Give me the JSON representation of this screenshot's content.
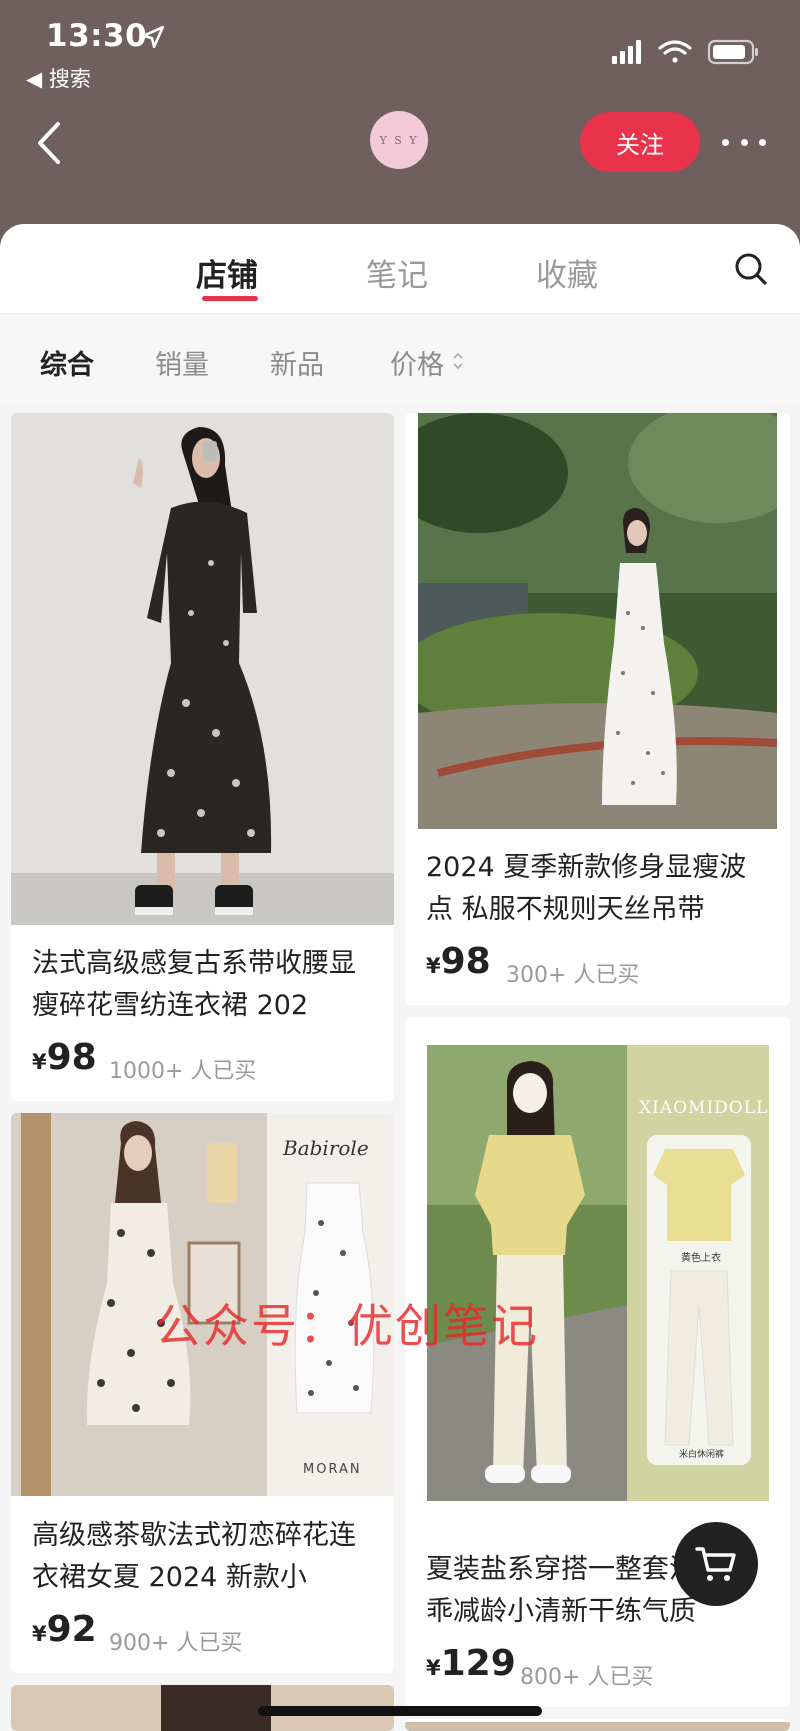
{
  "status_bar": {
    "time": "13:30",
    "back_app": "搜索"
  },
  "header": {
    "shop_logo_text": "Y S Y",
    "follow_label": "关注"
  },
  "tabs": [
    {
      "label": "店铺",
      "active": true
    },
    {
      "label": "笔记",
      "active": false
    },
    {
      "label": "收藏",
      "active": false
    }
  ],
  "sort": [
    {
      "label": "综合",
      "active": true
    },
    {
      "label": "销量",
      "active": false
    },
    {
      "label": "新品",
      "active": false
    },
    {
      "label": "价格",
      "active": false
    }
  ],
  "products": [
    {
      "title": "法式高级感复古系带收腰显瘦碎花雪纺连衣裙 202",
      "currency": "¥",
      "price": "98",
      "sold": "1000+ 人已买"
    },
    {
      "title": "2024 夏季新款修身显瘦波点 私服不规则天丝吊带",
      "currency": "¥",
      "price": "98",
      "sold": "300+ 人已买"
    },
    {
      "title": "高级感茶歇法式初恋碎花连衣裙女夏 2024 新款小",
      "currency": "¥",
      "price": "92",
      "sold": "900+ 人已买",
      "image_text": [
        "Babirole",
        "MORAN"
      ]
    },
    {
      "title": "夏装盐系穿搭一整套活泼奶乖减龄小清新干练气质",
      "currency": "¥",
      "price": "129",
      "sold": "800+ 人已买",
      "image_text": [
        "XIAOMIDOLLS",
        "黄色上衣",
        "米白休闲裤"
      ]
    }
  ],
  "watermark": "公众号：优创笔记",
  "colors": {
    "header_bg": "#6f5f5e",
    "accent": "#e8334a"
  }
}
